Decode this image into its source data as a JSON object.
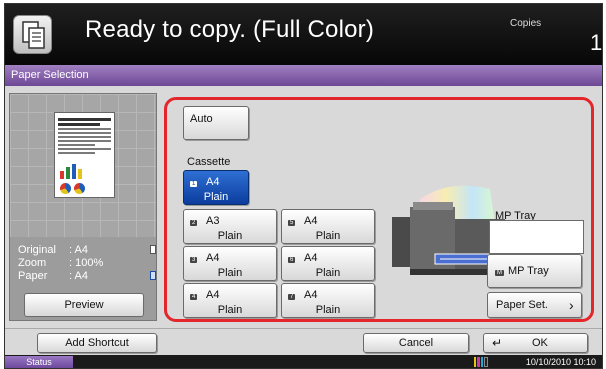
{
  "header": {
    "title": "Ready to copy. (Full Color)",
    "copies_label": "Copies",
    "copies_value": "1"
  },
  "panel": {
    "title": "Paper Selection"
  },
  "preview": {
    "info": [
      {
        "label": "Original",
        "value": ": A4"
      },
      {
        "label": "Zoom",
        "value": ": 100%"
      },
      {
        "label": "Paper",
        "value": ": A4"
      }
    ],
    "button_label": "Preview"
  },
  "selection": {
    "auto_label": "Auto",
    "cassette_label": "Cassette",
    "trays": [
      {
        "badge": "1",
        "size": "A4",
        "type": "Plain",
        "selected": true
      },
      {
        "badge": "2",
        "size": "A3",
        "type": "Plain",
        "selected": false
      },
      {
        "badge": "3",
        "size": "A4",
        "type": "Plain",
        "selected": false
      },
      {
        "badge": "4",
        "size": "A4",
        "type": "Plain",
        "selected": false
      },
      {
        "badge": "5",
        "size": "A4",
        "type": "Plain",
        "selected": false
      },
      {
        "badge": "6",
        "size": "A4",
        "type": "Plain",
        "selected": false
      },
      {
        "badge": "7",
        "size": "A4",
        "type": "Plain",
        "selected": false
      }
    ],
    "mp_tray_label": "MP Tray",
    "mp_tray_button": {
      "badge": "M",
      "label": "MP Tray"
    },
    "paper_set_label": "Paper Set.",
    "machine_tray_number": "1"
  },
  "footer": {
    "add_shortcut_label": "Add Shortcut",
    "cancel_label": "Cancel",
    "ok_label": "OK"
  },
  "statusbar": {
    "status_label": "Status",
    "datetime": "10/10/2010  10:10"
  },
  "colors": {
    "accent_purple": "#6d4895",
    "selected_blue": "#0b3d9e",
    "highlight_red": "#e3262c"
  }
}
